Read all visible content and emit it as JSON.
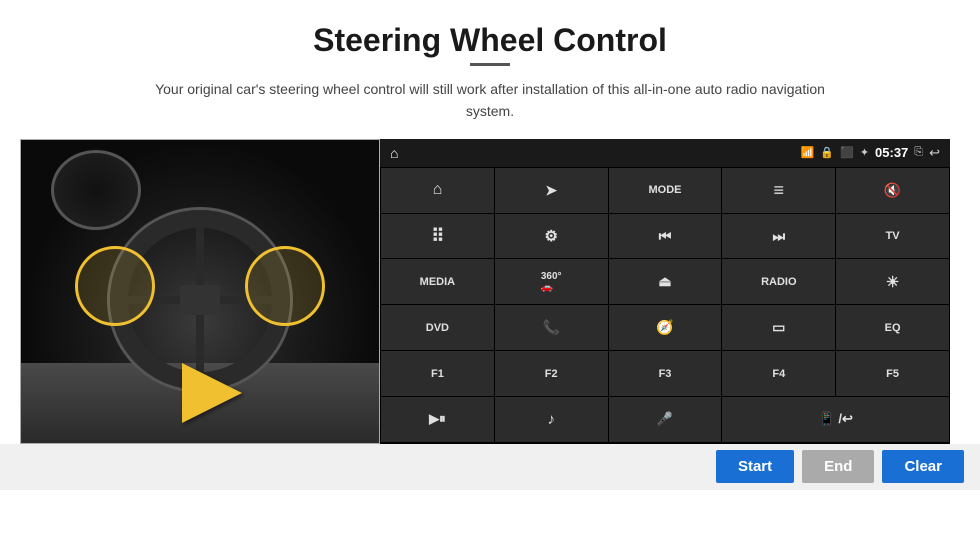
{
  "header": {
    "title": "Steering Wheel Control",
    "subtitle": "Your original car's steering wheel control will still work after installation of this all-in-one auto radio navigation system."
  },
  "status_bar": {
    "time": "05:37",
    "icons": [
      "wifi",
      "lock",
      "screen",
      "bt"
    ]
  },
  "grid_buttons": [
    {
      "id": "home",
      "label": "⌂",
      "type": "icon"
    },
    {
      "id": "nav-arrow",
      "label": "➤",
      "type": "icon"
    },
    {
      "id": "menu-list",
      "label": "≡",
      "type": "icon"
    },
    {
      "id": "vol-mute",
      "label": "🔇",
      "type": "icon"
    },
    {
      "id": "apps",
      "label": "⋮⋮⋮",
      "type": "icon"
    },
    {
      "id": "settings",
      "label": "⚙",
      "type": "icon"
    },
    {
      "id": "mode",
      "label": "MODE",
      "type": "text"
    },
    {
      "id": "prev",
      "label": "⏮",
      "type": "icon"
    },
    {
      "id": "next",
      "label": "⏭",
      "type": "icon"
    },
    {
      "id": "tv",
      "label": "TV",
      "type": "text"
    },
    {
      "id": "media",
      "label": "MEDIA",
      "type": "text"
    },
    {
      "id": "camera360",
      "label": "360°",
      "type": "icon"
    },
    {
      "id": "eject",
      "label": "⏏",
      "type": "icon"
    },
    {
      "id": "radio",
      "label": "RADIO",
      "type": "text"
    },
    {
      "id": "brightness",
      "label": "☀",
      "type": "icon"
    },
    {
      "id": "dvd",
      "label": "DVD",
      "type": "text"
    },
    {
      "id": "phone",
      "label": "📞",
      "type": "icon"
    },
    {
      "id": "navi",
      "label": "🧭",
      "type": "icon"
    },
    {
      "id": "window",
      "label": "▭",
      "type": "icon"
    },
    {
      "id": "eq",
      "label": "EQ",
      "type": "text"
    },
    {
      "id": "f1",
      "label": "F1",
      "type": "text"
    },
    {
      "id": "f2",
      "label": "F2",
      "type": "text"
    },
    {
      "id": "f3",
      "label": "F3",
      "type": "text"
    },
    {
      "id": "f4",
      "label": "F4",
      "type": "text"
    },
    {
      "id": "f5",
      "label": "F5",
      "type": "text"
    },
    {
      "id": "play-pause",
      "label": "▶⏸",
      "type": "icon"
    },
    {
      "id": "music",
      "label": "♪",
      "type": "icon"
    },
    {
      "id": "mic",
      "label": "🎤",
      "type": "icon"
    },
    {
      "id": "answer-call",
      "label": "📱",
      "type": "icon"
    }
  ],
  "bottom_bar": {
    "start_label": "Start",
    "end_label": "End",
    "clear_label": "Clear"
  },
  "colors": {
    "accent_blue": "#1a6fd4",
    "btn_disabled": "#aaaaaa",
    "screen_bg": "#1a1a1a",
    "grid_btn_bg": "#2c2c2c"
  }
}
